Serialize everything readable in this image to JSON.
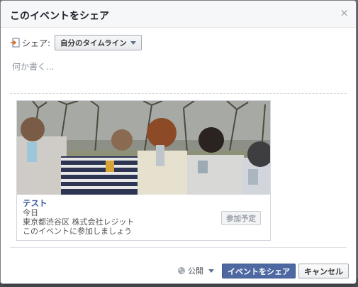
{
  "dialog": {
    "title": "このイベントをシェア",
    "close_icon": "×"
  },
  "share": {
    "label": "シェア:",
    "target_selected": "自分のタイムライン"
  },
  "compose": {
    "placeholder": "何か書く..."
  },
  "event_card": {
    "title": "テスト",
    "date": "今日",
    "location": "東京都渋谷区 株式会社レジット",
    "invite": "このイベントに参加しましょう",
    "join_label": "参加予定"
  },
  "footer": {
    "privacy_label": "公開",
    "share_button": "イベントをシェア",
    "cancel_button": "キャンセル"
  },
  "colors": {
    "accent": "#4e69a2",
    "link": "#3b5998"
  }
}
